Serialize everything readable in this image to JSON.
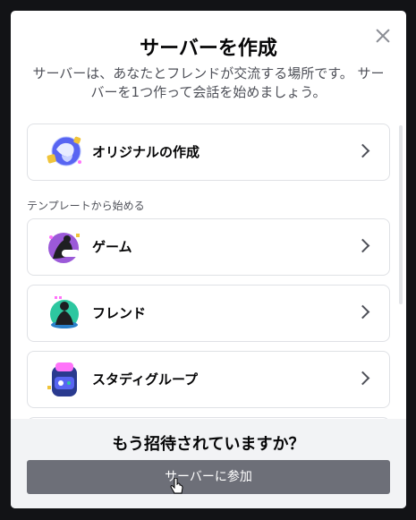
{
  "modal": {
    "title": "サーバーを作成",
    "subtitle": "サーバーは、あなたとフレンドが交流する場所です。 サーバーを1つ作って会話を始めましょう。",
    "create_own": {
      "label": "オリジナルの作成",
      "icon": "globe-creation-icon"
    },
    "templates_heading": "テンプレートから始める",
    "templates": [
      {
        "label": "ゲーム",
        "icon": "gaming-template-icon"
      },
      {
        "label": "フレンド",
        "icon": "friends-template-icon"
      },
      {
        "label": "スタディグループ",
        "icon": "study-group-template-icon"
      }
    ],
    "footer": {
      "title": "もう招待されていますか？",
      "join_label": "サーバーに参加"
    }
  },
  "colors": {
    "modal_bg": "#ffffff",
    "footer_bg": "#f2f3f5",
    "button_bg": "#6d6f78",
    "overlay": "#121316"
  }
}
